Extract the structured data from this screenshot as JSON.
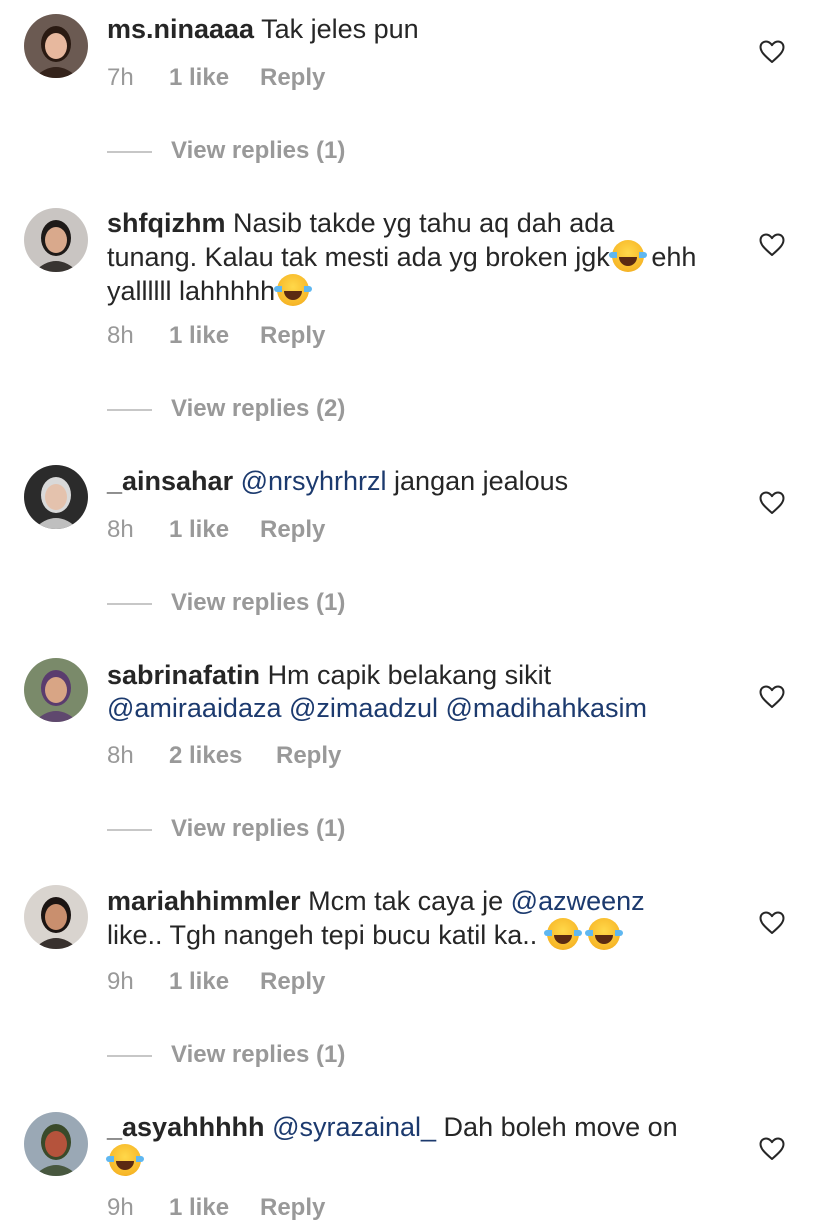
{
  "comments": [
    {
      "username": "ms.ninaaaa",
      "text_parts": [
        {
          "type": "text",
          "value": "Tak jeles pun"
        }
      ],
      "time": "7h",
      "likes": "1 like",
      "reply": "Reply",
      "view_replies": "View replies (1)",
      "avatar": {
        "skin": "#e7b89e",
        "hair": "#2a1a12",
        "bg": "#6b5a52"
      }
    },
    {
      "username": "shfqizhm",
      "text_parts": [
        {
          "type": "text",
          "value": "Nasib takde yg tahu aq dah ada tunang. Kalau tak mesti ada yg broken jgk"
        },
        {
          "type": "emoji",
          "value": "joy-emoji"
        },
        {
          "type": "text",
          "value": " ehh yallllll lahhhhh"
        },
        {
          "type": "emoji",
          "value": "rofl-emoji"
        }
      ],
      "time": "8h",
      "likes": "1 like",
      "reply": "Reply",
      "view_replies": "View replies (2)",
      "avatar": {
        "skin": "#d9a98c",
        "hair": "#1e1a18",
        "bg": "#c9c5c2"
      }
    },
    {
      "username": "_ainsahar",
      "text_parts": [
        {
          "type": "mention",
          "value": "@nrsyhrhrzl"
        },
        {
          "type": "text",
          "value": " jangan jealous"
        }
      ],
      "time": "8h",
      "likes": "1 like",
      "reply": "Reply",
      "view_replies": "View replies (1)",
      "avatar": {
        "skin": "#e4c2ad",
        "hair": "#d9d9d9",
        "bg": "#2b2b2b"
      }
    },
    {
      "username": "sabrinafatin",
      "text_parts": [
        {
          "type": "text",
          "value": "Hm capik belakang sikit "
        },
        {
          "type": "mention",
          "value": "@amiraaidaza"
        },
        {
          "type": "text",
          "value": " "
        },
        {
          "type": "mention",
          "value": "@zimaadzul"
        },
        {
          "type": "text",
          "value": " "
        },
        {
          "type": "mention",
          "value": "@madihahkasim"
        }
      ],
      "time": "8h",
      "likes": "2 likes",
      "reply": "Reply",
      "view_replies": "View replies (1)",
      "avatar": {
        "skin": "#d8a585",
        "hair": "#5a3c6e",
        "bg": "#7a8a6a"
      }
    },
    {
      "username": "mariahhimmler",
      "text_parts": [
        {
          "type": "text",
          "value": "Mcm tak caya je "
        },
        {
          "type": "mention",
          "value": "@azweenz"
        },
        {
          "type": "text",
          "value": " like.. Tgh nangeh tepi bucu katil ka.. "
        },
        {
          "type": "emoji",
          "value": "joy-emoji"
        },
        {
          "type": "text",
          "value": " "
        },
        {
          "type": "emoji",
          "value": "joy-emoji"
        }
      ],
      "time": "9h",
      "likes": "1 like",
      "reply": "Reply",
      "view_replies": "View replies (1)",
      "avatar": {
        "skin": "#c98f6e",
        "hair": "#1b1412",
        "bg": "#d9d4cf"
      }
    },
    {
      "username": "_asyahhhhh",
      "text_parts": [
        {
          "type": "mention",
          "value": "@syrazainal_"
        },
        {
          "type": "text",
          "value": "  Dah boleh move on "
        },
        {
          "type": "emoji",
          "value": "joy-emoji"
        }
      ],
      "time": "9h",
      "likes": "1 like",
      "reply": "Reply",
      "view_replies": "",
      "avatar": {
        "skin": "#b5533c",
        "hair": "#3a4a2a",
        "bg": "#9aa8b5"
      }
    }
  ],
  "colors": {
    "text": "#262626",
    "muted": "#999999",
    "mention": "#1c3a6e",
    "divider": "#c7c7c7"
  },
  "icons": {
    "like": "heart-outline-icon"
  }
}
